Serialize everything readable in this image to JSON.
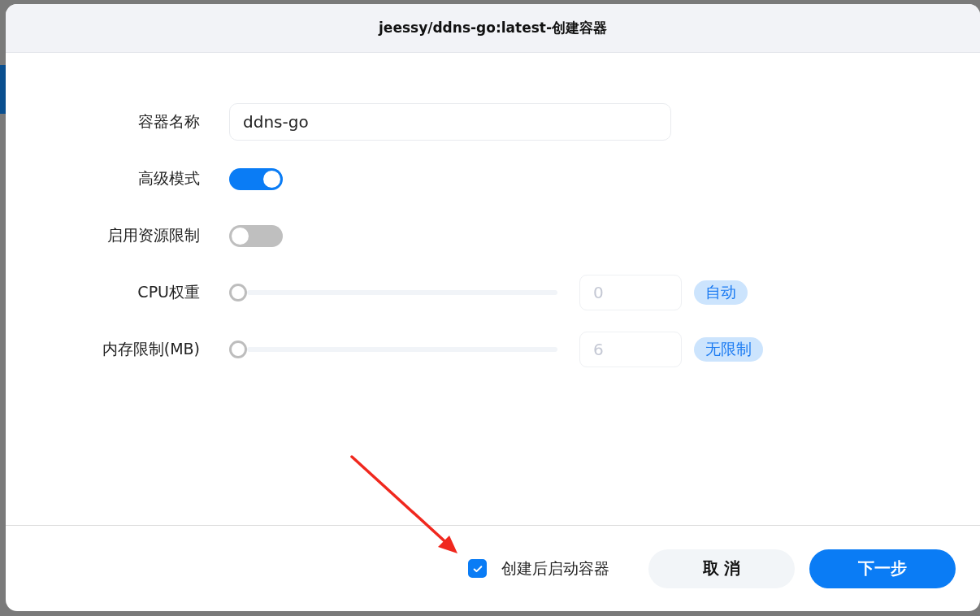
{
  "dialog": {
    "title": "jeessy/ddns-go:latest-创建容器"
  },
  "fields": [
    {
      "kind": "text",
      "label": "容器名称",
      "value": "ddns-go"
    },
    {
      "kind": "toggle",
      "label": "高级模式",
      "on": true
    },
    {
      "kind": "toggle",
      "label": "启用资源限制",
      "on": false
    },
    {
      "kind": "slider",
      "label": "CPU权重",
      "level": 0,
      "value": "0",
      "disabled": true,
      "tag": "自动"
    },
    {
      "kind": "slider",
      "label": "内存限制(MB)",
      "level": 0,
      "value": "6",
      "disabled": true,
      "tag": "无限制"
    }
  ],
  "footer": {
    "start_after_create": {
      "label": "创建后启动容器",
      "checked": true
    },
    "buttons": [
      {
        "kind": "secondary",
        "label": "取 消"
      },
      {
        "kind": "primary",
        "label": "下一步"
      }
    ]
  }
}
